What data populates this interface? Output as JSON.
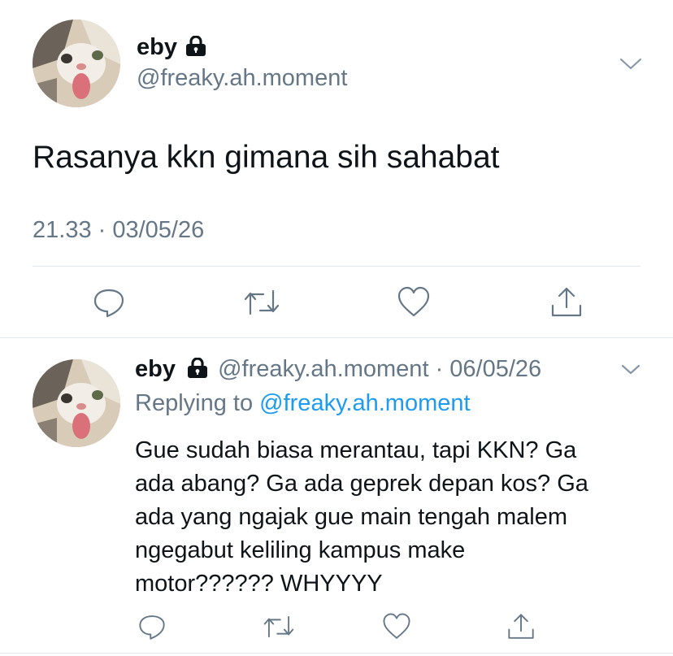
{
  "main_tweet": {
    "display_name": "eby",
    "handle": "@freaky.ah.moment",
    "text": "Rasanya kkn gimana sih sahabat",
    "timestamp": "21.33 · 03/05/26",
    "avatar_icon": "cat-avatar-icon"
  },
  "reply_tweet": {
    "display_name": "eby",
    "handle": "@freaky.ah.moment",
    "date": "· 06/05/26",
    "replying_label": "Replying to",
    "replying_handle": "@freaky.ah.moment",
    "text_lines": [
      "Gue sudah biasa merantau, tapi KKN? Ga",
      "ada abang? Ga ada geprek depan kos? Ga",
      "ada yang ngajak gue main tengah malem",
      "ngegabut keliling kampus make",
      "motor?????? WHYYYY"
    ]
  },
  "actions": [
    "reply-icon",
    "retweet-icon",
    "like-icon",
    "share-icon"
  ],
  "colors": {
    "text": "#0f1419",
    "secondary": "#657786",
    "link": "#1d9bf0",
    "divider": "#e1e8ed"
  }
}
